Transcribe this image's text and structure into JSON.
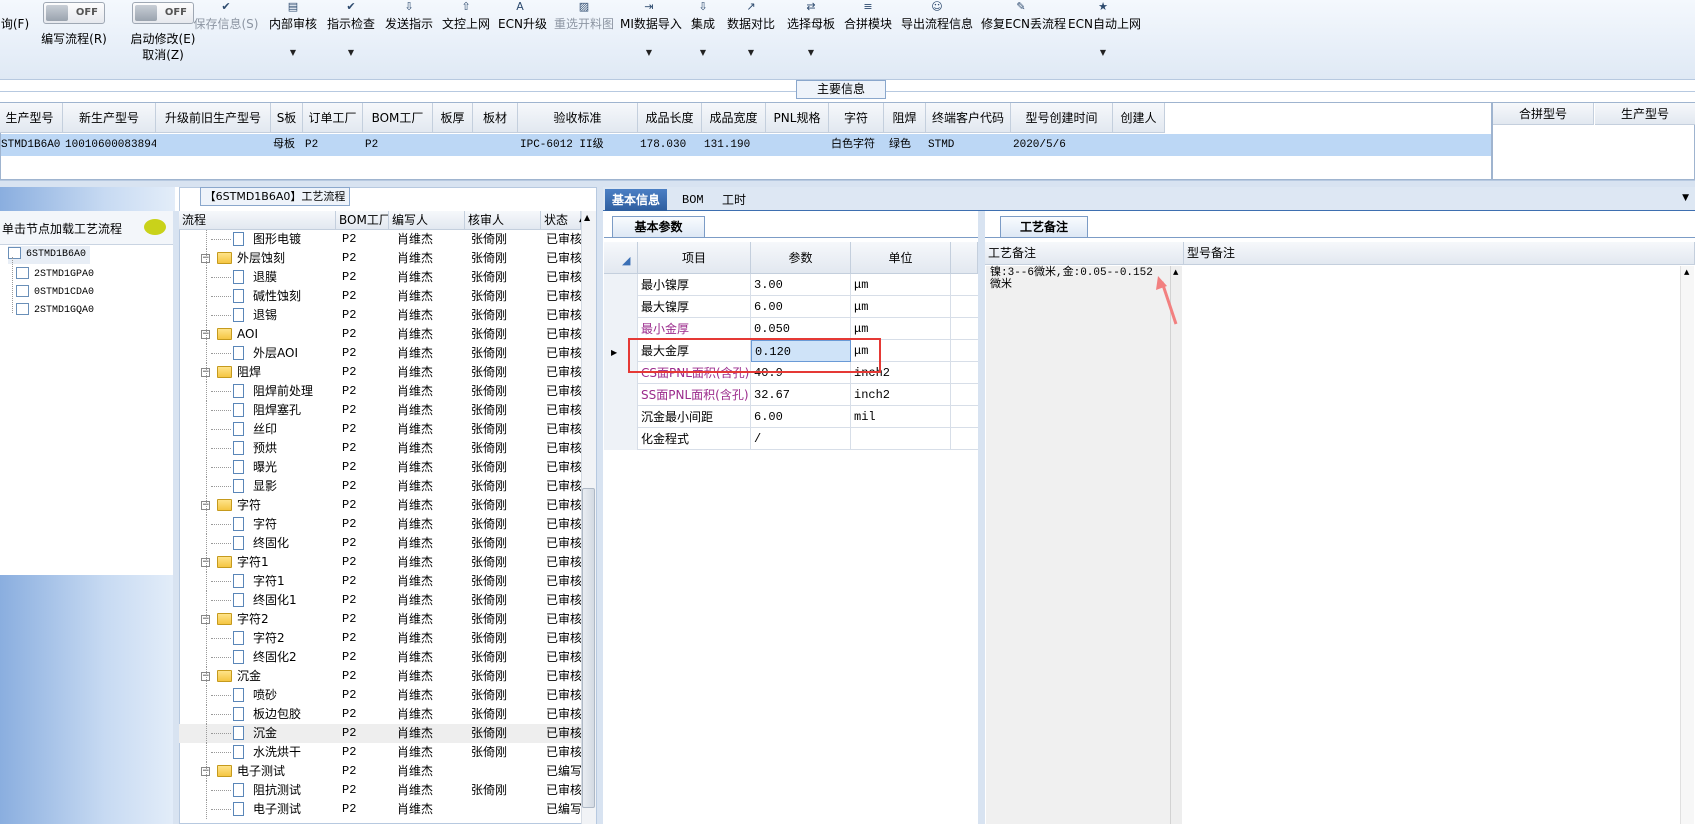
{
  "toolbar": {
    "items": [
      {
        "label": "询(F)",
        "icon": "",
        "sub": ""
      },
      {
        "label": "编写流程(R)",
        "toggle": "OFF"
      },
      {
        "label": "启动修改(E)",
        "label2": "取消(Z)",
        "toggle": "OFF"
      },
      {
        "label": "保存信息(S)",
        "icon": "save-icon",
        "disabled": true
      },
      {
        "label": "内部审核",
        "icon": "print-icon",
        "arrow": true
      },
      {
        "label": "指示检查",
        "icon": "check-icon",
        "arrow": true
      },
      {
        "label": "发送指示",
        "icon": "send-icon"
      },
      {
        "label": "文控上网",
        "icon": "upload-icon"
      },
      {
        "label": "ECN升级",
        "icon": "A-icon"
      },
      {
        "label": "重选开料图",
        "icon": "image-icon",
        "disabled": true
      },
      {
        "label": "MI数据导入",
        "icon": "import-icon",
        "arrow": true
      },
      {
        "label": "集成",
        "icon": "download-icon",
        "arrow": true
      },
      {
        "label": "数据对比",
        "icon": "compare-icon",
        "arrow": true
      },
      {
        "label": "选择母板",
        "icon": "shuffle-icon",
        "arrow": true
      },
      {
        "label": "合拼模块",
        "icon": "list-icon"
      },
      {
        "label": "导出流程信息",
        "icon": "export-icon"
      },
      {
        "label": "修复ECN丢流程",
        "icon": "wrench-icon"
      },
      {
        "label": "ECN自动上网",
        "icon": "star-icon",
        "arrow": true
      }
    ]
  },
  "main_info_label": "主要信息",
  "main_grid": {
    "headers": [
      "生产型号",
      "新生产型号",
      "升级前旧生产型号",
      "S板",
      "订单工厂",
      "BOM工厂",
      "板厚",
      "板材",
      "验收标准",
      "成品长度",
      "成品宽度",
      "PNL规格",
      "字符",
      "阻焊",
      "终端客户代码",
      "型号创建时间",
      "创建人"
    ],
    "row": [
      "STMD1B6A0",
      "10010600083894",
      "",
      "母板",
      "P2",
      "P2",
      "",
      "",
      "IPC-6012 II级",
      "178.030",
      "131.190",
      "",
      "白色字符",
      "绿色",
      "STMD",
      "2020/5/6",
      ""
    ]
  },
  "side_grid": {
    "headers": [
      "合拼型号",
      "生产型号"
    ]
  },
  "left_panel": {
    "header": "单击节点加载工艺流程",
    "tree": [
      "6STMD1B6A0",
      "2STMD1GPA0",
      "0STMD1CDA0",
      "2STMD1GQA0"
    ]
  },
  "flow": {
    "title": "【6STMD1B6A0】工艺流程",
    "headers": [
      "流程",
      "BOM工厂",
      "编写人",
      "核审人",
      "状态"
    ],
    "rows": [
      {
        "level": 2,
        "name": "图形电镀",
        "bom": "P2",
        "writer": "肖维杰",
        "reviewer": "张倚刚",
        "status": "已审核"
      },
      {
        "level": 1,
        "name": "外层蚀刻",
        "bom": "P2",
        "writer": "肖维杰",
        "reviewer": "张倚刚",
        "status": "已审核"
      },
      {
        "level": 2,
        "name": "退膜",
        "bom": "P2",
        "writer": "肖维杰",
        "reviewer": "张倚刚",
        "status": "已审核"
      },
      {
        "level": 2,
        "name": "碱性蚀刻",
        "bom": "P2",
        "writer": "肖维杰",
        "reviewer": "张倚刚",
        "status": "已审核"
      },
      {
        "level": 2,
        "name": "退锡",
        "bom": "P2",
        "writer": "肖维杰",
        "reviewer": "张倚刚",
        "status": "已审核"
      },
      {
        "level": 1,
        "name": "AOI",
        "bom": "P2",
        "writer": "肖维杰",
        "reviewer": "张倚刚",
        "status": "已审核"
      },
      {
        "level": 2,
        "name": "外层AOI",
        "bom": "P2",
        "writer": "肖维杰",
        "reviewer": "张倚刚",
        "status": "已审核"
      },
      {
        "level": 1,
        "name": "阻焊",
        "bom": "P2",
        "writer": "肖维杰",
        "reviewer": "张倚刚",
        "status": "已审核"
      },
      {
        "level": 2,
        "name": "阻焊前处理",
        "bom": "P2",
        "writer": "肖维杰",
        "reviewer": "张倚刚",
        "status": "已审核"
      },
      {
        "level": 2,
        "name": "阻焊塞孔",
        "bom": "P2",
        "writer": "肖维杰",
        "reviewer": "张倚刚",
        "status": "已审核"
      },
      {
        "level": 2,
        "name": "丝印",
        "bom": "P2",
        "writer": "肖维杰",
        "reviewer": "张倚刚",
        "status": "已审核"
      },
      {
        "level": 2,
        "name": "预烘",
        "bom": "P2",
        "writer": "肖维杰",
        "reviewer": "张倚刚",
        "status": "已审核"
      },
      {
        "level": 2,
        "name": "曝光",
        "bom": "P2",
        "writer": "肖维杰",
        "reviewer": "张倚刚",
        "status": "已审核"
      },
      {
        "level": 2,
        "name": "显影",
        "bom": "P2",
        "writer": "肖维杰",
        "reviewer": "张倚刚",
        "status": "已审核"
      },
      {
        "level": 1,
        "name": "字符",
        "bom": "P2",
        "writer": "肖维杰",
        "reviewer": "张倚刚",
        "status": "已审核"
      },
      {
        "level": 2,
        "name": "字符",
        "bom": "P2",
        "writer": "肖维杰",
        "reviewer": "张倚刚",
        "status": "已审核"
      },
      {
        "level": 2,
        "name": "终固化",
        "bom": "P2",
        "writer": "肖维杰",
        "reviewer": "张倚刚",
        "status": "已审核"
      },
      {
        "level": 1,
        "name": "字符1",
        "bom": "P2",
        "writer": "肖维杰",
        "reviewer": "张倚刚",
        "status": "已审核"
      },
      {
        "level": 2,
        "name": "字符1",
        "bom": "P2",
        "writer": "肖维杰",
        "reviewer": "张倚刚",
        "status": "已审核"
      },
      {
        "level": 2,
        "name": "终固化1",
        "bom": "P2",
        "writer": "肖维杰",
        "reviewer": "张倚刚",
        "status": "已审核"
      },
      {
        "level": 1,
        "name": "字符2",
        "bom": "P2",
        "writer": "肖维杰",
        "reviewer": "张倚刚",
        "status": "已审核"
      },
      {
        "level": 2,
        "name": "字符2",
        "bom": "P2",
        "writer": "肖维杰",
        "reviewer": "张倚刚",
        "status": "已审核"
      },
      {
        "level": 2,
        "name": "终固化2",
        "bom": "P2",
        "writer": "肖维杰",
        "reviewer": "张倚刚",
        "status": "已审核"
      },
      {
        "level": 1,
        "name": "沉金",
        "bom": "P2",
        "writer": "肖维杰",
        "reviewer": "张倚刚",
        "status": "已审核"
      },
      {
        "level": 2,
        "name": "喷砂",
        "bom": "P2",
        "writer": "肖维杰",
        "reviewer": "张倚刚",
        "status": "已审核"
      },
      {
        "level": 2,
        "name": "板边包胶",
        "bom": "P2",
        "writer": "肖维杰",
        "reviewer": "张倚刚",
        "status": "已审核"
      },
      {
        "level": 2,
        "name": "沉金",
        "bom": "P2",
        "writer": "肖维杰",
        "reviewer": "张倚刚",
        "status": "已审核",
        "selected": true
      },
      {
        "level": 2,
        "name": "水洗烘干",
        "bom": "P2",
        "writer": "肖维杰",
        "reviewer": "张倚刚",
        "status": "已审核"
      },
      {
        "level": 1,
        "name": "电子测试",
        "bom": "P2",
        "writer": "肖维杰",
        "reviewer": "",
        "status": "已编写"
      },
      {
        "level": 2,
        "name": "阻抗测试",
        "bom": "P2",
        "writer": "肖维杰",
        "reviewer": "张倚刚",
        "status": "已审核"
      },
      {
        "level": 2,
        "name": "电子测试",
        "bom": "P2",
        "writer": "肖维杰",
        "reviewer": "",
        "status": "已编写"
      }
    ]
  },
  "detail_tabs": [
    "基本信息",
    "BOM",
    "工时"
  ],
  "params": {
    "tab": "基本参数",
    "headers": [
      "项目",
      "参数",
      "单位"
    ],
    "rows": [
      {
        "item": "最小镍厚",
        "value": "3.00",
        "unit": "μm",
        "purple": false
      },
      {
        "item": "最大镍厚",
        "value": "6.00",
        "unit": "μm",
        "purple": false
      },
      {
        "item": "最小金厚",
        "value": "0.050",
        "unit": "μm",
        "purple": true
      },
      {
        "item": "最大金厚",
        "value": "0.120",
        "unit": "μm",
        "purple": false,
        "current": true
      },
      {
        "item": "CS面PNL面积(含孔)",
        "value": "40.9",
        "unit": "inch2",
        "purple": true
      },
      {
        "item": "SS面PNL面积(含孔)",
        "value": "32.67",
        "unit": "inch2",
        "purple": true
      },
      {
        "item": "沉金最小间距",
        "value": "6.00",
        "unit": "mil",
        "purple": false
      },
      {
        "item": "化金程式",
        "value": "/",
        "unit": "",
        "purple": false
      }
    ]
  },
  "notes": {
    "tab": "工艺备注",
    "col1": "工艺备注",
    "col2": "型号备注",
    "text": "镍:3--6微米,金:0.05--0.152微米"
  },
  "colors": {
    "accent": "#2e5e9f",
    "selection": "#bcd7f5",
    "highlight_box": "#e53935",
    "purple_text": "#9b2b8c"
  }
}
